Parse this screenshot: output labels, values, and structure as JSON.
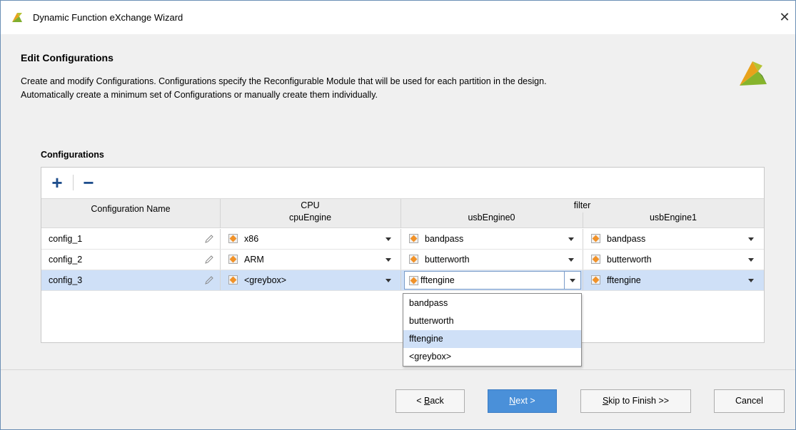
{
  "window": {
    "title": "Dynamic Function eXchange Wizard"
  },
  "header": {
    "title": "Edit Configurations",
    "description_line1": "Create and modify Configurations. Configurations specify the Reconfigurable Module that will be used for each partition in the design.",
    "description_line2": "Automatically create a minimum set of Configurations or manually create them individually."
  },
  "configurations": {
    "label": "Configurations",
    "columns": {
      "name": "Configuration Name",
      "group_cpu": "CPU",
      "cpu_engine": "cpuEngine",
      "group_filter": "filter",
      "usb_engine0": "usbEngine0",
      "usb_engine1": "usbEngine1"
    },
    "rows": [
      {
        "name": "config_1",
        "cpu": "x86",
        "usb0": "bandpass",
        "usb1": "bandpass"
      },
      {
        "name": "config_2",
        "cpu": "ARM",
        "usb0": "butterworth",
        "usb1": "butterworth"
      },
      {
        "name": "config_3",
        "cpu": "<greybox>",
        "usb0": "fftengine",
        "usb1": "fftengine"
      }
    ],
    "dropdown_options": [
      "bandpass",
      "butterworth",
      "fftengine",
      "<greybox>"
    ],
    "dropdown_selected": "fftengine"
  },
  "buttons": {
    "back_prefix": "< ",
    "back_key": "B",
    "back_rest": "ack",
    "next_key": "N",
    "next_rest": "ext >",
    "skip_key": "S",
    "skip_rest": "kip to Finish >>",
    "cancel": "Cancel"
  },
  "colors": {
    "accent": "#4a90d9",
    "selection": "#cfe0f7",
    "module_icon": "#f0922a",
    "toolbar_icon": "#1f4e8c"
  }
}
